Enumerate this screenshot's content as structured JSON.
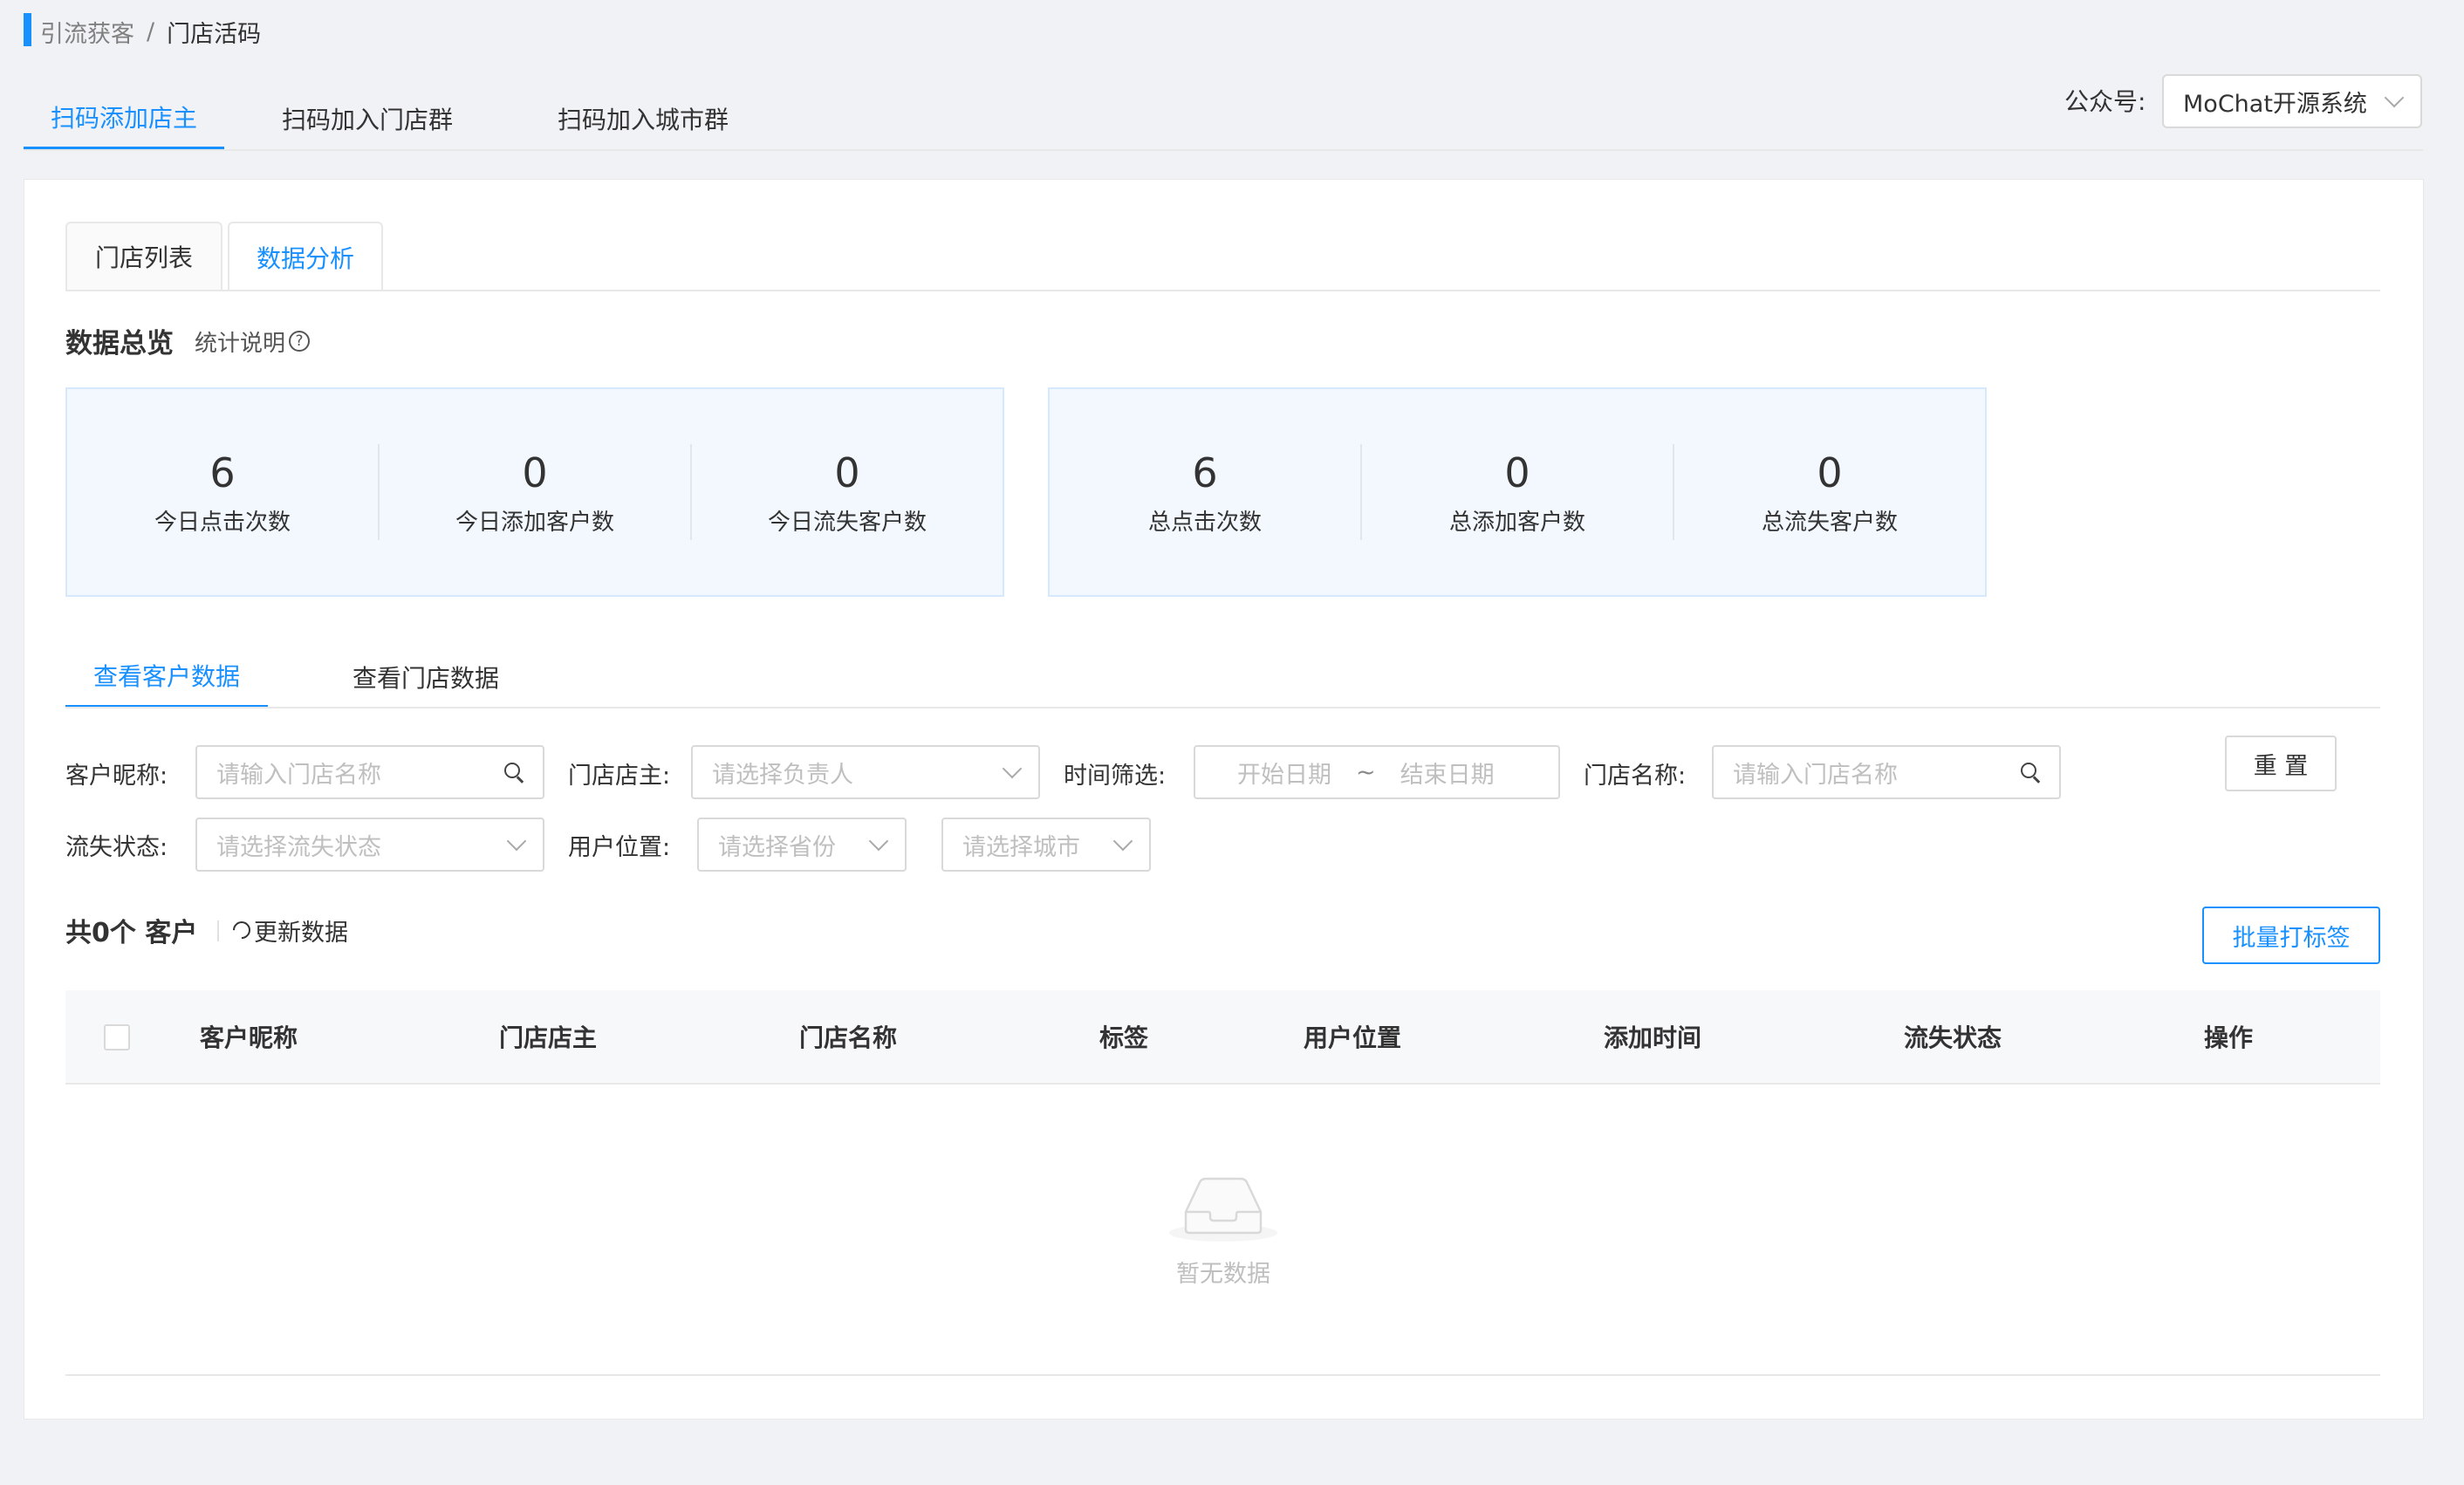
{
  "breadcrumb": {
    "parent": "引流获客",
    "separator": "/",
    "current": "门店活码"
  },
  "top_tabs": [
    {
      "label": "扫码添加店主",
      "active": true
    },
    {
      "label": "扫码加入门店群",
      "active": false
    },
    {
      "label": "扫码加入城市群",
      "active": false
    }
  ],
  "account": {
    "label": "公众号:",
    "value": "MoChat开源系统"
  },
  "card_tabs": [
    {
      "label": "门店列表",
      "active": false
    },
    {
      "label": "数据分析",
      "active": true
    }
  ],
  "overview": {
    "title": "数据总览",
    "help": "统计说明",
    "today": [
      {
        "value": "6",
        "label": "今日点击次数"
      },
      {
        "value": "0",
        "label": "今日添加客户数"
      },
      {
        "value": "0",
        "label": "今日流失客户数"
      }
    ],
    "total": [
      {
        "value": "6",
        "label": "总点击次数"
      },
      {
        "value": "0",
        "label": "总添加客户数"
      },
      {
        "value": "0",
        "label": "总流失客户数"
      }
    ]
  },
  "sub_tabs": [
    {
      "label": "查看客户数据",
      "active": true
    },
    {
      "label": "查看门店数据",
      "active": false
    }
  ],
  "filters": {
    "nickname_label": "客户昵称:",
    "nickname_placeholder": "请输入门店名称",
    "owner_label": "门店店主:",
    "owner_placeholder": "请选择负责人",
    "time_label": "时间筛选:",
    "start_placeholder": "开始日期",
    "range_sep": "~",
    "end_placeholder": "结束日期",
    "store_label": "门店名称:",
    "store_placeholder": "请输入门店名称",
    "reset": "重 置",
    "lost_label": "流失状态:",
    "lost_placeholder": "请选择流失状态",
    "location_label": "用户位置:",
    "province_placeholder": "请选择省份",
    "city_placeholder": "请选择城市"
  },
  "summary": {
    "total": "共0个 客户",
    "refresh": "更新数据",
    "batch_tag": "批量打标签"
  },
  "table": {
    "columns": [
      "客户昵称",
      "门店店主",
      "门店名称",
      "标签",
      "用户位置",
      "添加时间",
      "流失状态",
      "操作"
    ],
    "empty": "暂无数据"
  }
}
